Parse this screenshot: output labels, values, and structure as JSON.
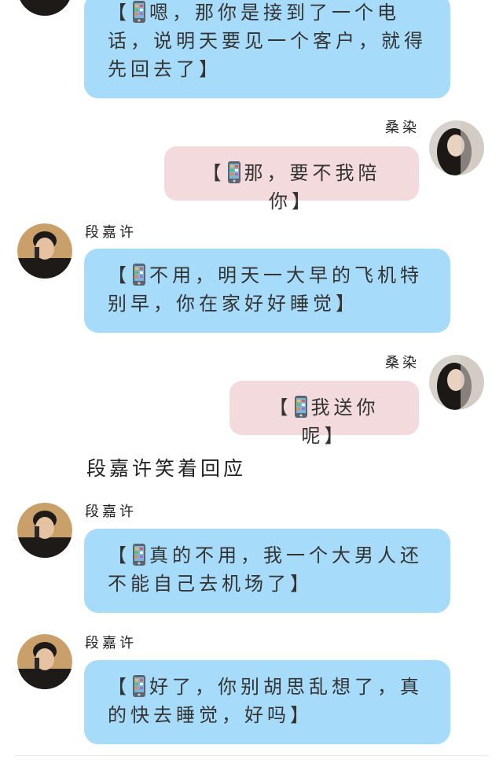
{
  "colors": {
    "left_bubble": "#a6dcfa",
    "right_bubble": "#f3dadd",
    "background": "#ffffff"
  },
  "icons": {
    "message_prefix": "mobile-phone-icon"
  },
  "messages": [
    {
      "side": "left",
      "speaker": "",
      "open": "【",
      "close": "】",
      "text": "嗯，那你是接到了一个电话，说明天要见一个客户，就得先回去了"
    },
    {
      "side": "right",
      "speaker": "桑染",
      "open": "【",
      "close": "】",
      "text": "那，要不我陪你"
    },
    {
      "side": "left",
      "speaker": "段嘉许",
      "open": "【",
      "close": "】",
      "text": "不用，明天一大早的飞机特别早，你在家好好睡觉"
    },
    {
      "side": "right",
      "speaker": "桑染",
      "open": "【",
      "close": "】",
      "text": "我送你呢"
    },
    {
      "side": "left",
      "speaker": "段嘉许",
      "open": "【",
      "close": "】",
      "text": "真的不用，我一个大男人还不能自己去机场了"
    },
    {
      "side": "left",
      "speaker": "段嘉许",
      "open": "【",
      "close": "】",
      "text": "好了，你别胡思乱想了，真的快去睡觉，好吗"
    }
  ],
  "narration": "段嘉许笑着回应"
}
